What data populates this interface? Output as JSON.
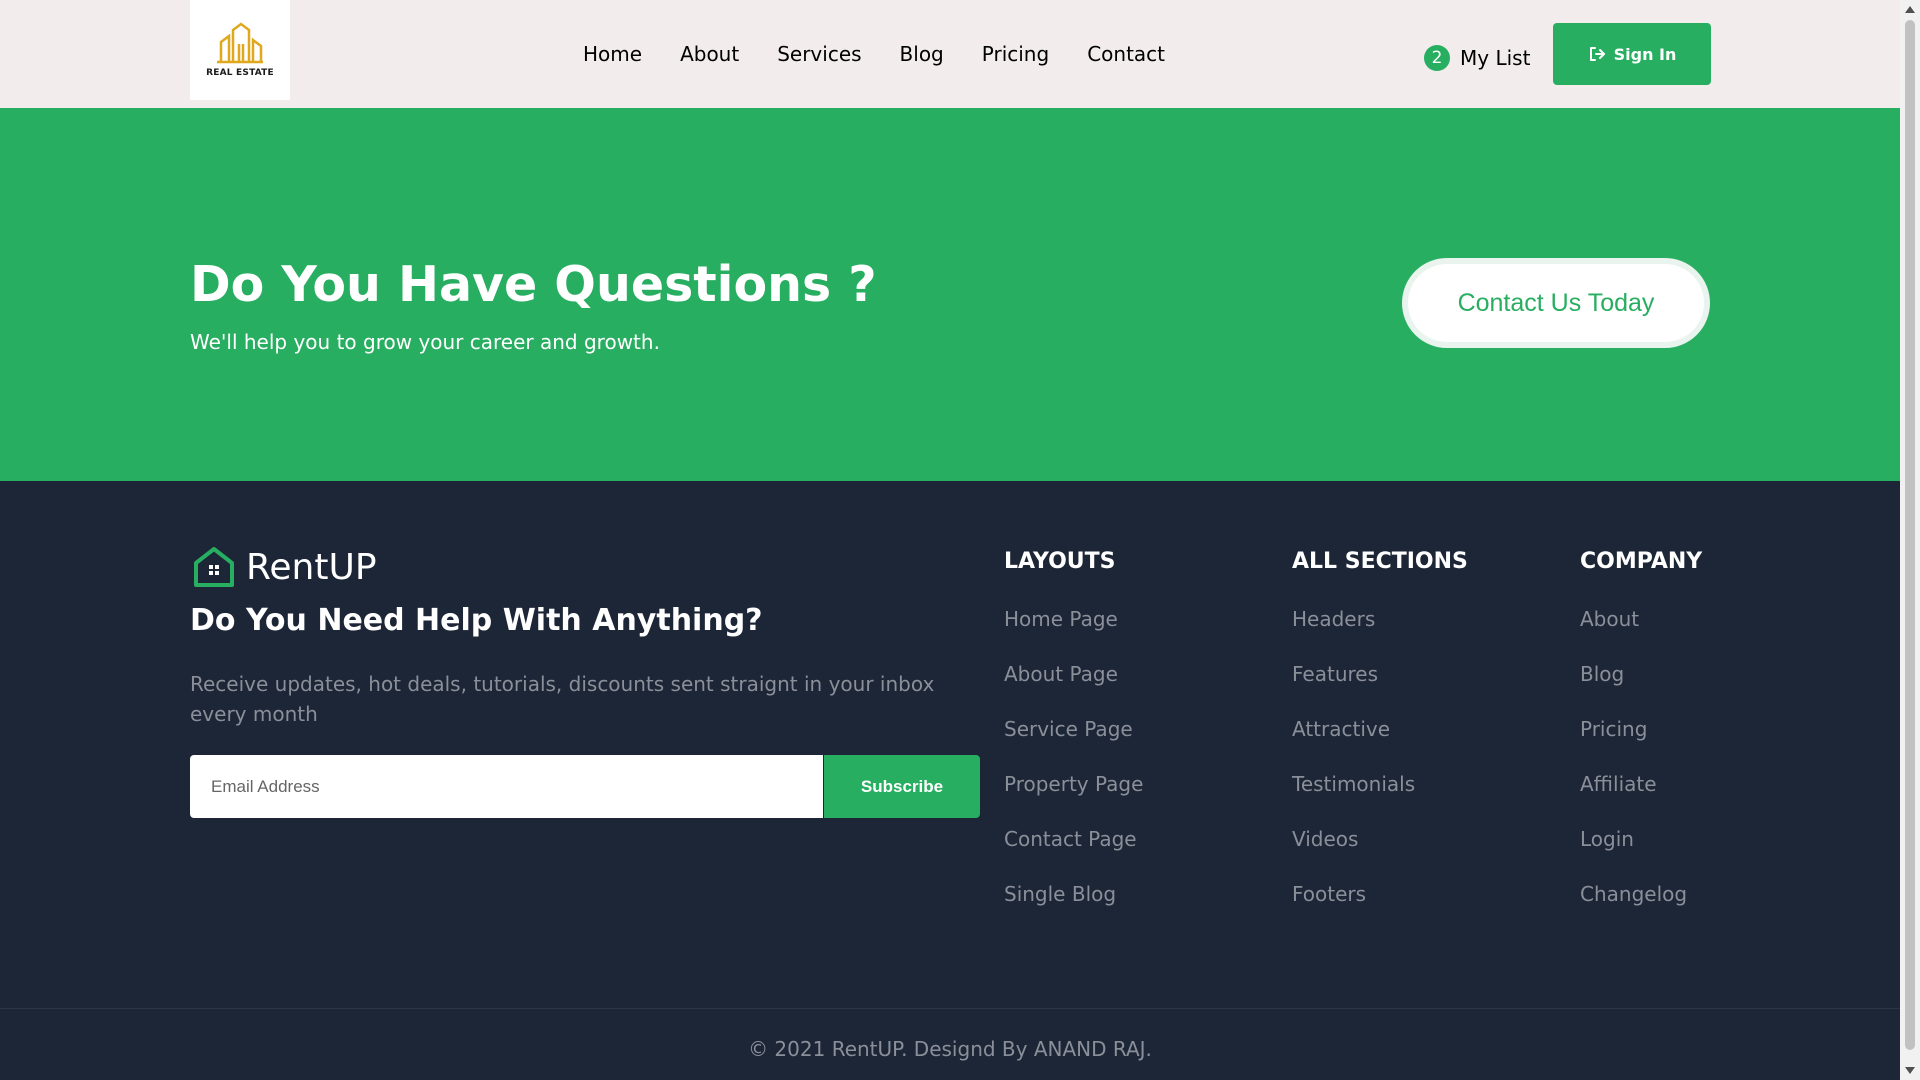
{
  "header": {
    "logo_text": "REAL ESTATE",
    "nav": [
      "Home",
      "About",
      "Services",
      "Blog",
      "Pricing",
      "Contact"
    ],
    "mylist_count": "2",
    "mylist_label": "My List",
    "signin_label": "Sign In",
    "signin_icon": "sign-in-icon"
  },
  "hero": {
    "title": "Do You Have Questions ?",
    "subtitle": "We'll help you to grow your career and growth.",
    "cta_label": "Contact Us Today"
  },
  "footer": {
    "brand_name": "RentUP",
    "help_title": "Do You Need Help With Anything?",
    "help_text": "Receive updates, hot deals, tutorials, discounts sent straignt in your inbox every month",
    "email_placeholder": "Email Address",
    "subscribe_label": "Subscribe",
    "columns": [
      {
        "title": "LAYOUTS",
        "items": [
          "Home Page",
          "About Page",
          "Service Page",
          "Property Page",
          "Contact Page",
          "Single Blog"
        ]
      },
      {
        "title": "ALL SECTIONS",
        "items": [
          "Headers",
          "Features",
          "Attractive",
          "Testimonials",
          "Videos",
          "Footers"
        ]
      },
      {
        "title": "COMPANY",
        "items": [
          "About",
          "Blog",
          "Pricing",
          "Affiliate",
          "Login",
          "Changelog"
        ]
      }
    ],
    "copyright": "© 2021 RentUP. Designd By ANAND RAJ."
  },
  "colors": {
    "accent": "#27ae60",
    "footer_bg": "#1d2636",
    "header_bg": "#f2ecec"
  }
}
